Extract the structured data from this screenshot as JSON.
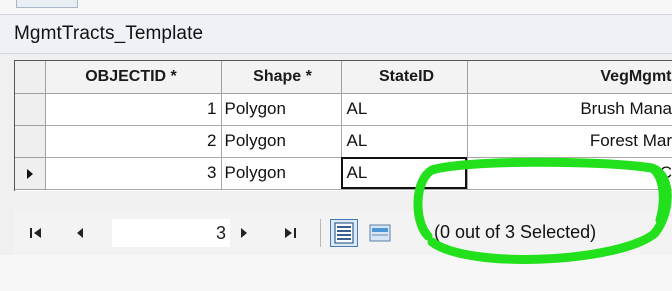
{
  "window": {
    "title": "MgmtTracts_Template"
  },
  "table": {
    "columns": [
      "OBJECTID *",
      "Shape *",
      "StateID",
      "VegMgmt"
    ],
    "rows": [
      {
        "objectid": "1",
        "shape": "Polygon",
        "stateid": "AL",
        "vegmgmt": "Brush Mana"
      },
      {
        "objectid": "2",
        "shape": "Polygon",
        "stateid": "AL",
        "vegmgmt": "Forest Mar"
      },
      {
        "objectid": "3",
        "shape": "Polygon",
        "stateid": "AL",
        "vegmgmt": "C"
      }
    ],
    "current_row": 3
  },
  "navigation": {
    "current_record": "3",
    "selection_status": "(0 out of 3 Selected)",
    "icons": {
      "first": "first-record-icon",
      "prev": "previous-record-icon",
      "next": "next-record-icon",
      "last": "last-record-icon",
      "show_all": "show-all-records-icon",
      "show_selected": "show-selected-records-icon"
    }
  },
  "annotation": {
    "highlight_color": "#22e11c"
  }
}
